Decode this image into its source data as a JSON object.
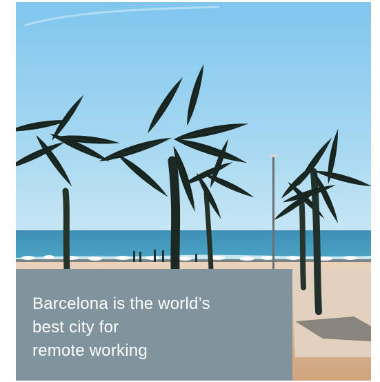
{
  "article": {
    "headline": "Barcelona is the world’s\nbest city for\nremote working"
  },
  "photo": {
    "subject_icons": [
      "palm-tree-icon",
      "beach-umbrella-icon",
      "sea-icon",
      "lamp-post-icon"
    ],
    "colors": {
      "sky_top": "#7fc6ee",
      "sky_bottom": "#c7e6f4",
      "sea": "#3d95bb",
      "sand": "#d8b28c",
      "caption_panel": "#7f949c"
    }
  }
}
